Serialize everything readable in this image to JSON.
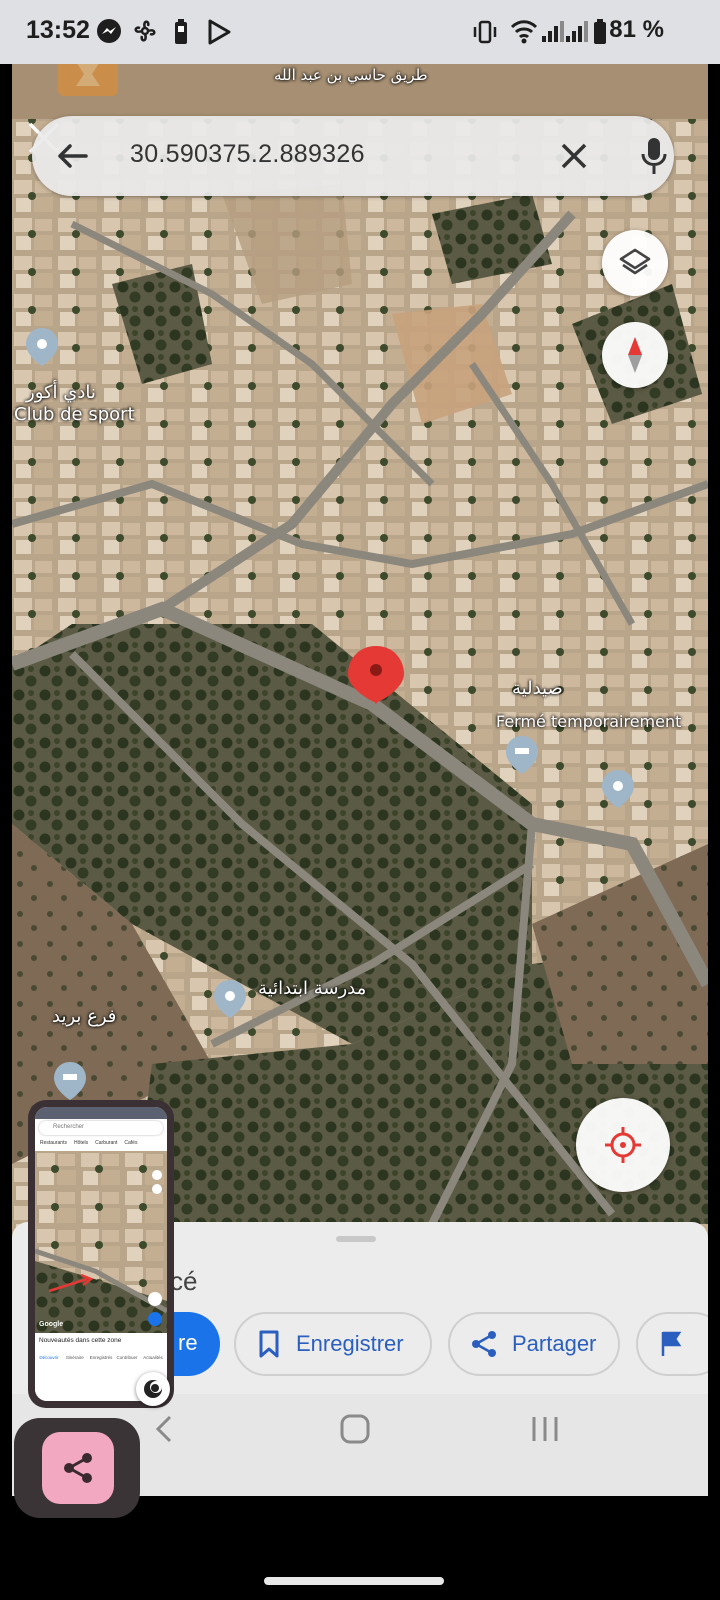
{
  "status_bar": {
    "time": "13:52",
    "battery_percent": "81 %",
    "icons": [
      "messenger-icon",
      "fan-icon",
      "battery-saver-icon",
      "play-store-icon",
      "vibrate-icon",
      "wifi-icon",
      "signal-icon",
      "signal-icon",
      "battery-icon"
    ]
  },
  "search": {
    "query": "30.590375.2.889326"
  },
  "map": {
    "pin_color": "#e53935",
    "poi_labels": {
      "club_ar": "نادي أكور",
      "club_fr": "Club de sport",
      "pharmacy_ar": "صيدلية",
      "pharmacy_fr": "Fermé temporairement",
      "primary_school": "مدرسة ابتدائية",
      "left_poi": "فرع بريد",
      "road_top": "طريق حاسي بن عبد الله"
    }
  },
  "bottom_sheet": {
    "title_fragment": "cé",
    "primary_chip_fragment": "re",
    "save_label": "Enregistrer",
    "share_label": "Partager"
  },
  "thumbnail": {
    "search_placeholder": "Rechercher",
    "chips": [
      "Restaurants",
      "Hôtels",
      "Carburant",
      "Cafés"
    ],
    "google_logo": "Google",
    "news_title": "Nouveautés dans cette zone",
    "tabs": [
      "Découvrir",
      "Itinéraire",
      "Enregistrés",
      "Contribuer",
      "Actualités"
    ]
  },
  "colors": {
    "accent": "#1a73e8",
    "share_fab": "#f3a8c2",
    "status_bar_bg": "#dfe0e4"
  }
}
